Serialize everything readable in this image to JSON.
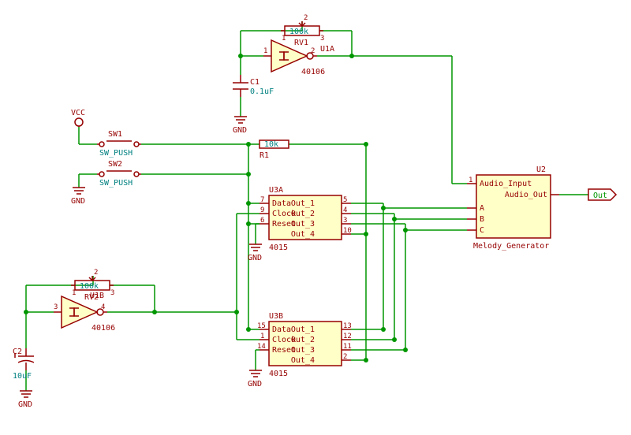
{
  "power": {
    "vcc": "VCC",
    "gnd": "GND"
  },
  "sw1": {
    "ref": "SW1",
    "val": "SW_PUSH"
  },
  "sw2": {
    "ref": "SW2",
    "val": "SW_PUSH"
  },
  "rv1": {
    "ref": "RV1",
    "val": "100k",
    "pins": {
      "p1": "1",
      "p2": "2",
      "p3": "3"
    }
  },
  "rv2": {
    "ref": "RV2",
    "val": "100k",
    "pins": {
      "p1": "1",
      "p2": "2",
      "p3": "3"
    }
  },
  "u1a": {
    "ref": "U1A",
    "val": "40106",
    "pins": {
      "in": "1",
      "out": "2"
    }
  },
  "u1b": {
    "ref": "U1B",
    "val": "40106",
    "pins": {
      "in": "3",
      "out": "4"
    }
  },
  "c1": {
    "ref": "C1",
    "val": "0.1uF"
  },
  "c2": {
    "ref": "C2",
    "val": "10uF"
  },
  "r1": {
    "ref": "R1",
    "val": "10k"
  },
  "u3a": {
    "ref": "U3A",
    "val": "4015",
    "pins": {
      "data": {
        "num": "7",
        "name": "Data"
      },
      "clock": {
        "num": "9",
        "name": "Clock"
      },
      "reset": {
        "num": "6",
        "name": "Reset"
      },
      "out1": {
        "num": "5",
        "name": "Out_1"
      },
      "out2": {
        "num": "4",
        "name": "Out_2"
      },
      "out3": {
        "num": "3",
        "name": "Out_3"
      },
      "out4": {
        "num": "10",
        "name": "Out_4"
      }
    }
  },
  "u3b": {
    "ref": "U3B",
    "val": "4015",
    "pins": {
      "data": {
        "num": "15",
        "name": "Data"
      },
      "clock": {
        "num": "1",
        "name": "Clock"
      },
      "reset": {
        "num": "14",
        "name": "Reset"
      },
      "out1": {
        "num": "13",
        "name": "Out_1"
      },
      "out2": {
        "num": "12",
        "name": "Out_2"
      },
      "out3": {
        "num": "11",
        "name": "Out_3"
      },
      "out4": {
        "num": "2",
        "name": "Out_4"
      }
    }
  },
  "u2": {
    "ref": "U2",
    "val": "Melody_Generator",
    "pins": {
      "ain": {
        "num": "1",
        "name": "Audio_Input"
      },
      "aout": {
        "name": "Audio_Out"
      },
      "a": {
        "name": "A"
      },
      "b": {
        "name": "B"
      },
      "c": {
        "name": "C"
      }
    }
  },
  "out_label": "Out"
}
